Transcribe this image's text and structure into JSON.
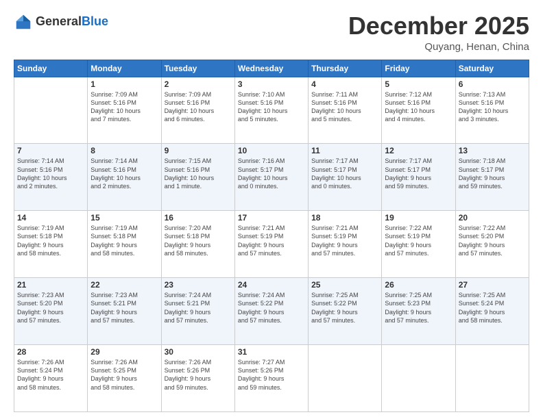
{
  "header": {
    "logo_general": "General",
    "logo_blue": "Blue",
    "month_title": "December 2025",
    "location": "Quyang, Henan, China"
  },
  "weekdays": [
    "Sunday",
    "Monday",
    "Tuesday",
    "Wednesday",
    "Thursday",
    "Friday",
    "Saturday"
  ],
  "weeks": [
    [
      {
        "day": "",
        "info": ""
      },
      {
        "day": "1",
        "info": "Sunrise: 7:09 AM\nSunset: 5:16 PM\nDaylight: 10 hours\nand 7 minutes."
      },
      {
        "day": "2",
        "info": "Sunrise: 7:09 AM\nSunset: 5:16 PM\nDaylight: 10 hours\nand 6 minutes."
      },
      {
        "day": "3",
        "info": "Sunrise: 7:10 AM\nSunset: 5:16 PM\nDaylight: 10 hours\nand 5 minutes."
      },
      {
        "day": "4",
        "info": "Sunrise: 7:11 AM\nSunset: 5:16 PM\nDaylight: 10 hours\nand 5 minutes."
      },
      {
        "day": "5",
        "info": "Sunrise: 7:12 AM\nSunset: 5:16 PM\nDaylight: 10 hours\nand 4 minutes."
      },
      {
        "day": "6",
        "info": "Sunrise: 7:13 AM\nSunset: 5:16 PM\nDaylight: 10 hours\nand 3 minutes."
      }
    ],
    [
      {
        "day": "7",
        "info": "Sunrise: 7:14 AM\nSunset: 5:16 PM\nDaylight: 10 hours\nand 2 minutes."
      },
      {
        "day": "8",
        "info": "Sunrise: 7:14 AM\nSunset: 5:16 PM\nDaylight: 10 hours\nand 2 minutes."
      },
      {
        "day": "9",
        "info": "Sunrise: 7:15 AM\nSunset: 5:16 PM\nDaylight: 10 hours\nand 1 minute."
      },
      {
        "day": "10",
        "info": "Sunrise: 7:16 AM\nSunset: 5:17 PM\nDaylight: 10 hours\nand 0 minutes."
      },
      {
        "day": "11",
        "info": "Sunrise: 7:17 AM\nSunset: 5:17 PM\nDaylight: 10 hours\nand 0 minutes."
      },
      {
        "day": "12",
        "info": "Sunrise: 7:17 AM\nSunset: 5:17 PM\nDaylight: 9 hours\nand 59 minutes."
      },
      {
        "day": "13",
        "info": "Sunrise: 7:18 AM\nSunset: 5:17 PM\nDaylight: 9 hours\nand 59 minutes."
      }
    ],
    [
      {
        "day": "14",
        "info": "Sunrise: 7:19 AM\nSunset: 5:18 PM\nDaylight: 9 hours\nand 58 minutes."
      },
      {
        "day": "15",
        "info": "Sunrise: 7:19 AM\nSunset: 5:18 PM\nDaylight: 9 hours\nand 58 minutes."
      },
      {
        "day": "16",
        "info": "Sunrise: 7:20 AM\nSunset: 5:18 PM\nDaylight: 9 hours\nand 58 minutes."
      },
      {
        "day": "17",
        "info": "Sunrise: 7:21 AM\nSunset: 5:19 PM\nDaylight: 9 hours\nand 57 minutes."
      },
      {
        "day": "18",
        "info": "Sunrise: 7:21 AM\nSunset: 5:19 PM\nDaylight: 9 hours\nand 57 minutes."
      },
      {
        "day": "19",
        "info": "Sunrise: 7:22 AM\nSunset: 5:19 PM\nDaylight: 9 hours\nand 57 minutes."
      },
      {
        "day": "20",
        "info": "Sunrise: 7:22 AM\nSunset: 5:20 PM\nDaylight: 9 hours\nand 57 minutes."
      }
    ],
    [
      {
        "day": "21",
        "info": "Sunrise: 7:23 AM\nSunset: 5:20 PM\nDaylight: 9 hours\nand 57 minutes."
      },
      {
        "day": "22",
        "info": "Sunrise: 7:23 AM\nSunset: 5:21 PM\nDaylight: 9 hours\nand 57 minutes."
      },
      {
        "day": "23",
        "info": "Sunrise: 7:24 AM\nSunset: 5:21 PM\nDaylight: 9 hours\nand 57 minutes."
      },
      {
        "day": "24",
        "info": "Sunrise: 7:24 AM\nSunset: 5:22 PM\nDaylight: 9 hours\nand 57 minutes."
      },
      {
        "day": "25",
        "info": "Sunrise: 7:25 AM\nSunset: 5:22 PM\nDaylight: 9 hours\nand 57 minutes."
      },
      {
        "day": "26",
        "info": "Sunrise: 7:25 AM\nSunset: 5:23 PM\nDaylight: 9 hours\nand 57 minutes."
      },
      {
        "day": "27",
        "info": "Sunrise: 7:25 AM\nSunset: 5:24 PM\nDaylight: 9 hours\nand 58 minutes."
      }
    ],
    [
      {
        "day": "28",
        "info": "Sunrise: 7:26 AM\nSunset: 5:24 PM\nDaylight: 9 hours\nand 58 minutes."
      },
      {
        "day": "29",
        "info": "Sunrise: 7:26 AM\nSunset: 5:25 PM\nDaylight: 9 hours\nand 58 minutes."
      },
      {
        "day": "30",
        "info": "Sunrise: 7:26 AM\nSunset: 5:26 PM\nDaylight: 9 hours\nand 59 minutes."
      },
      {
        "day": "31",
        "info": "Sunrise: 7:27 AM\nSunset: 5:26 PM\nDaylight: 9 hours\nand 59 minutes."
      },
      {
        "day": "",
        "info": ""
      },
      {
        "day": "",
        "info": ""
      },
      {
        "day": "",
        "info": ""
      }
    ]
  ]
}
